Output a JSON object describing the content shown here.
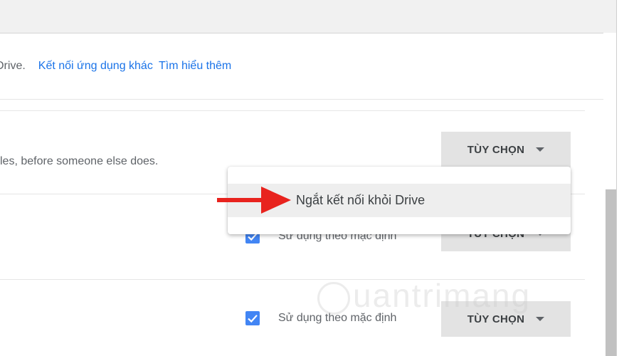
{
  "header": {
    "intro_text": "Drive.",
    "connect_link": "Kết nối ứng dụng khác",
    "learn_link": "Tìm hiểu thêm"
  },
  "rows": [
    {
      "description": "les, before someone else does.",
      "options_label": "TÙY CHỌN"
    },
    {
      "checkbox_label": "Sử dụng theo mặc định",
      "checked": true,
      "options_label": "TÙY CHỌN"
    },
    {
      "checkbox_label": "Sử dụng theo mặc định",
      "checked": true,
      "options_label": "TÙY CHỌN"
    }
  ],
  "menu": {
    "items": [
      {
        "label": "Ngắt kết nối khỏi Drive"
      }
    ]
  },
  "watermark": {
    "text": "uantrimang"
  },
  "colors": {
    "link": "#1a73e8",
    "checkbox": "#4285f4",
    "arrow": "#e8231e",
    "button_bg": "#e3e3e3"
  },
  "icons": {
    "caret": "caret-down-icon",
    "check": "check-icon",
    "arrow": "red-arrow-icon"
  }
}
